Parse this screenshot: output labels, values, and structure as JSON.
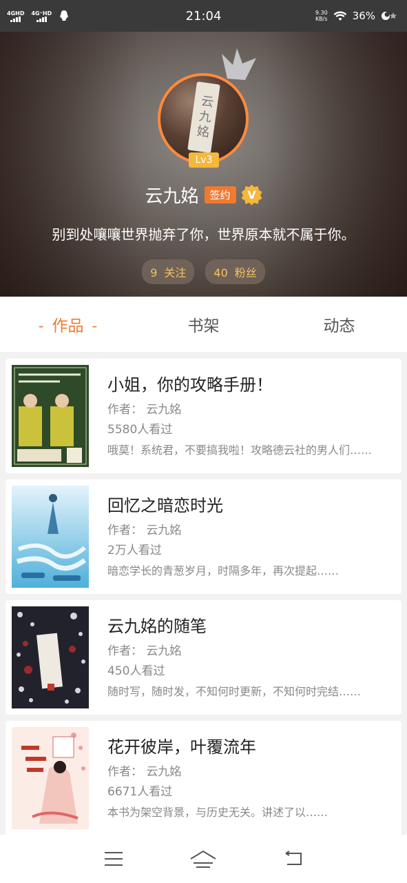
{
  "status_bar": {
    "net1": "4GHD",
    "net2": "4G⁺HD",
    "time": "21:04",
    "speed_value": "9.30",
    "speed_unit": "KB/s",
    "battery": "36%"
  },
  "profile": {
    "level": "Lv3",
    "name": "云九姳",
    "sign_badge": "签约",
    "verified_badge": "V",
    "avatar_text": "云九姳",
    "motto": "别到处嚷嚷世界抛弃了你，世界原本就不属于你。",
    "following_count": "9",
    "following_label": "关注",
    "followers_count": "40",
    "followers_label": "粉丝"
  },
  "tabs": [
    {
      "label": "作品",
      "active": true
    },
    {
      "label": "书架",
      "active": false
    },
    {
      "label": "动态",
      "active": false
    }
  ],
  "tab_dash": "-",
  "books": [
    {
      "title": "小姐，你的攻略手册！",
      "author": "作者： 云九姳",
      "views": "5580人看过",
      "desc": "哦莫！系统君，不要搞我啦！攻略德云社的男人们……"
    },
    {
      "title": "回忆之暗恋时光",
      "author": "作者： 云九姳",
      "views": "2万人看过",
      "desc": "暗恋学长的青葱岁月，时隔多年，再次提起……"
    },
    {
      "title": "云九姳的随笔",
      "author": "作者： 云九姳",
      "views": "450人看过",
      "desc": "随时写，随时发，不知何时更新，不知何时完结……"
    },
    {
      "title": "花开彼岸，叶覆流年",
      "author": "作者： 云九姳",
      "views": "6671人看过",
      "desc": "本书为架空背景，与历史无关。讲述了以……"
    }
  ]
}
